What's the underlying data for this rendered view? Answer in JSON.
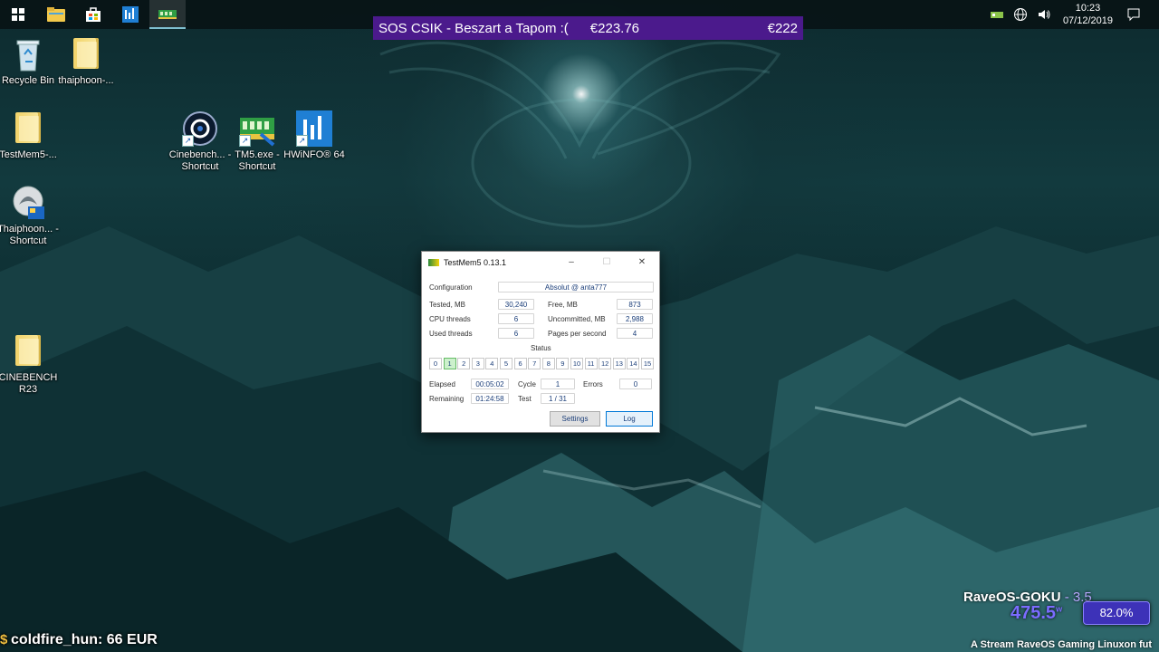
{
  "colors": {
    "taskbar": "#08141a",
    "ticker_bg": "#4b1a8c",
    "rave_accent": "#7b6cff",
    "cell_done": "#ccf0cc"
  },
  "taskbar": {
    "buttons": [
      {
        "name": "windows-start",
        "icon": "windows-logo-icon"
      },
      {
        "name": "file-explorer",
        "icon": "folder-icon"
      },
      {
        "name": "microsoft-store",
        "icon": "store-bag-icon"
      },
      {
        "name": "hwinfo",
        "icon": "hwinfo-icon"
      },
      {
        "name": "testmem5",
        "icon": "ram-module-icon",
        "active": true
      }
    ],
    "tray_icons": [
      "network-adapter-icon",
      "globe-icon",
      "speaker-icon",
      "notification-icon"
    ],
    "clock_time": "10:23",
    "clock_date": "07/12/2019"
  },
  "ticker": {
    "message": "SOS CSIK - Beszart a Tapom :(",
    "amount_left": "€223.76",
    "amount_right": "€222"
  },
  "desktop_icons": [
    {
      "label": "Recycle Bin",
      "icon": "recycle-bin-icon"
    },
    {
      "label": "thaiphoon-...",
      "icon": "folder-icon"
    },
    {
      "label": "TestMem5-...",
      "icon": "folder-icon"
    },
    {
      "label": "Cinebench... - Shortcut",
      "icon": "cinebench-icon"
    },
    {
      "label": "TM5.exe - Shortcut",
      "icon": "ram-module-icon"
    },
    {
      "label": "HWiNFO® 64",
      "icon": "hwinfo-icon"
    },
    {
      "label": "Thaiphoon... - Shortcut",
      "icon": "thaiphoon-icon"
    },
    {
      "label": "CINEBENCH R23",
      "icon": "folder-icon"
    }
  ],
  "testmem": {
    "title": "TestMem5  0.13.1",
    "config_label": "Configuration",
    "config_value": "Absolut @ anta777",
    "tested_label": "Tested, MB",
    "tested_value": "30,240",
    "free_label": "Free, MB",
    "free_value": "873",
    "cpu_threads_label": "CPU threads",
    "cpu_threads_value": "6",
    "uncommitted_label": "Uncommitted, MB",
    "uncommitted_value": "2,988",
    "used_threads_label": "Used threads",
    "used_threads_value": "6",
    "pages_label": "Pages per second",
    "pages_value": "4",
    "status_label": "Status",
    "status_cells": [
      "0",
      "1",
      "2",
      "3",
      "4",
      "5",
      "6",
      "7",
      "8",
      "9",
      "10",
      "11",
      "12",
      "13",
      "14",
      "15"
    ],
    "status_active_index": 1,
    "elapsed_label": "Elapsed",
    "elapsed_value": "00:05:02",
    "cycle_label": "Cycle",
    "cycle_value": "1",
    "errors_label": "Errors",
    "errors_value": "0",
    "remaining_label": "Remaining",
    "remaining_value": "01:24:58",
    "test_label": "Test",
    "test_value": "1 / 31",
    "settings_label": "Settings",
    "log_label": "Log"
  },
  "overlay": {
    "donor": "coldfire_hun: 66 EUR",
    "rave_title": "RaveOS-GOKU",
    "rave_version": " - 3.5",
    "rave_watts": "475.5",
    "rave_watts_unit": "w",
    "rave_percent": "82.0%",
    "footer": "A Stream RaveOS Gaming Linuxon fut"
  }
}
